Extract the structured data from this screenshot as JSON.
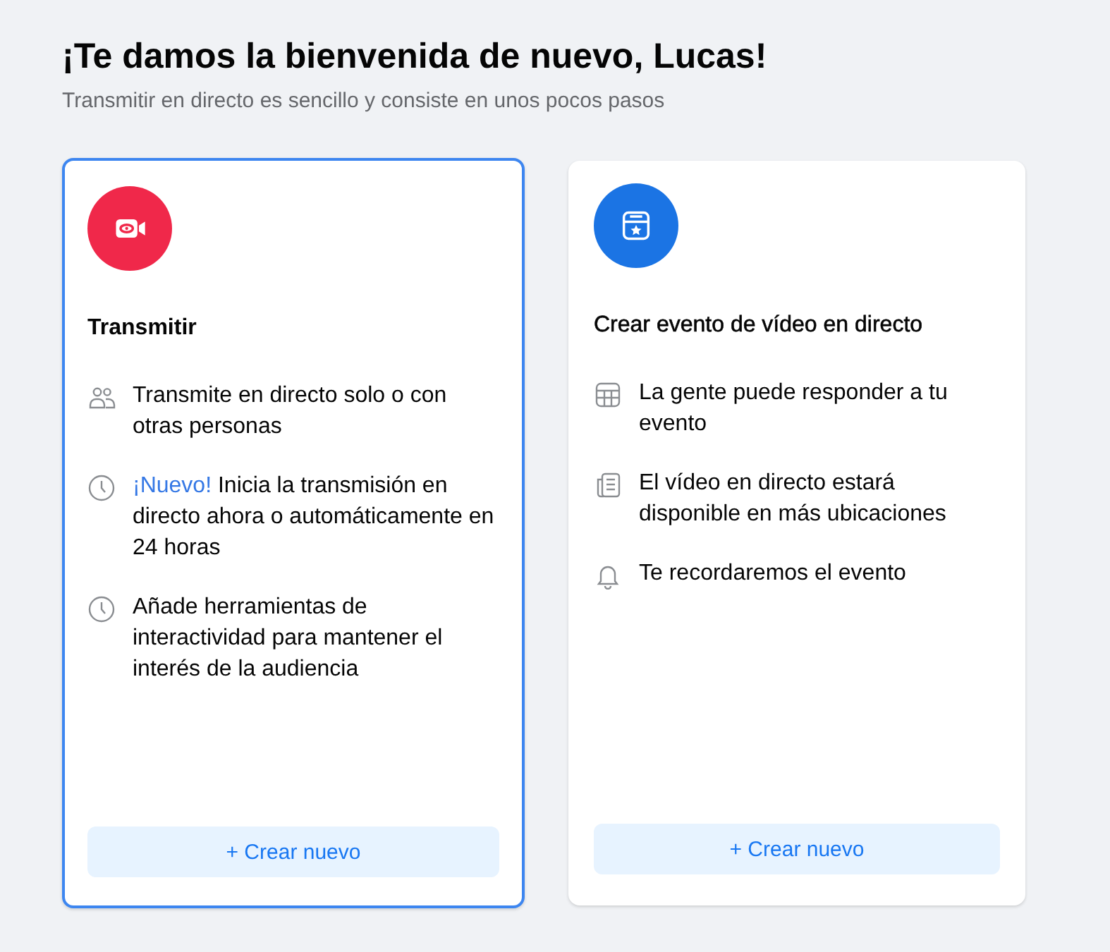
{
  "header": {
    "title": "¡Te damos la bienvenida de nuevo, Lucas!",
    "subtitle": "Transmitir en directo es sencillo y consiste en unos pocos pasos"
  },
  "cards": [
    {
      "kind": "video",
      "selected": true,
      "title": "Transmitir",
      "features": [
        {
          "kind": "people",
          "text": "Transmite en directo solo o con otras personas"
        },
        {
          "kind": "clock",
          "badge": "¡Nuevo!",
          "text": "Inicia la transmisión en directo ahora o automáticamente en 24 horas"
        },
        {
          "kind": "clock",
          "text": "Añade herramientas de interactividad para mantener el interés de la audiencia"
        }
      ],
      "button": "+ Crear nuevo"
    },
    {
      "kind": "event",
      "selected": false,
      "title": "Crear evento de vídeo en directo",
      "features": [
        {
          "kind": "calendar",
          "text": "La gente puede responder a tu evento"
        },
        {
          "kind": "news",
          "text": "El vídeo en directo estará disponible en más ubicaciones"
        },
        {
          "kind": "bell",
          "text": "Te recordaremos el evento"
        }
      ],
      "button": "+ Crear nuevo"
    }
  ]
}
